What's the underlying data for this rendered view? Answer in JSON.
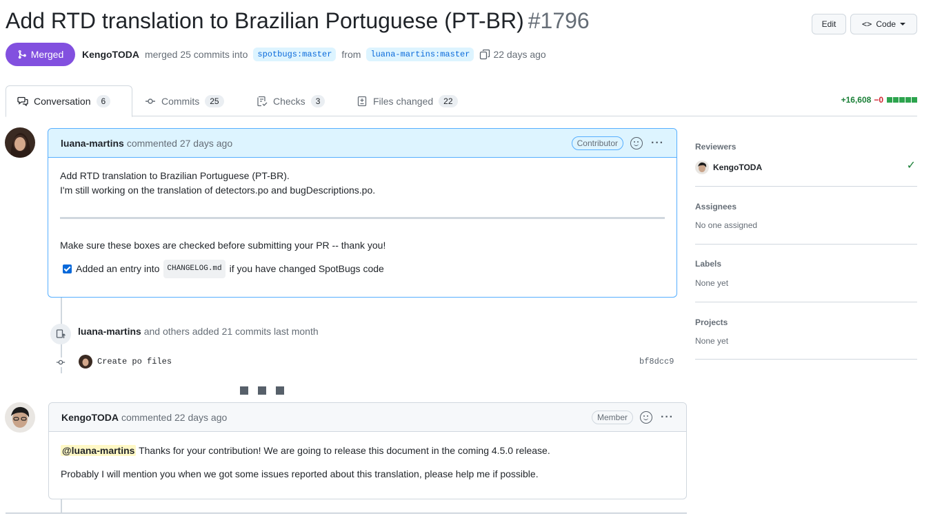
{
  "header": {
    "title": "Add RTD translation to Brazilian Portuguese (PT-BR)",
    "number": "#1796",
    "edit_label": "Edit",
    "code_label": "Code"
  },
  "meta": {
    "state": "Merged",
    "author": "KengoTODA",
    "merged_text": "merged 25 commits into",
    "base_branch": "spotbugs:master",
    "from_text": "from",
    "head_branch": "luana-martins:master",
    "time": "22 days ago"
  },
  "tabs": [
    {
      "label": "Conversation",
      "count": "6",
      "icon": "comment-discussion-icon"
    },
    {
      "label": "Commits",
      "count": "25",
      "icon": "git-commit-icon"
    },
    {
      "label": "Checks",
      "count": "3",
      "icon": "checklist-icon"
    },
    {
      "label": "Files changed",
      "count": "22",
      "icon": "file-diff-icon"
    }
  ],
  "diffstat": {
    "additions": "+16,608",
    "deletions": "−0"
  },
  "comment1": {
    "author": "luana-martins",
    "action": "commented 27 days ago",
    "role": "Contributor",
    "line1": "Add RTD translation to Brazilian Portuguese (PT-BR).",
    "line2": "I'm still working on the translation of detectors.po and bugDescriptions.po.",
    "checklist_intro": "Make sure these boxes are checked before submitting your PR -- thank you!",
    "check_prefix": "Added an entry into",
    "check_code": "CHANGELOG.md",
    "check_suffix": "if you have changed SpotBugs code"
  },
  "commits_event": {
    "author": "luana-martins",
    "text": "and others added 21 commits last month",
    "commit_message": "Create po files",
    "commit_sha": "bf8dcc9"
  },
  "comment2": {
    "author": "KengoTODA",
    "action": "commented 22 days ago",
    "role": "Member",
    "mention": "@luana-martins",
    "line1": "Thanks for your contribution! We are going to release this document in the coming 4.5.0 release.",
    "line2": "Probably I will mention you when we got some issues reported about this translation, please help me if possible."
  },
  "sidebar": {
    "reviewers_title": "Reviewers",
    "reviewer": "KengoTODA",
    "assignees_title": "Assignees",
    "assignees_value": "No one assigned",
    "labels_title": "Labels",
    "labels_value": "None yet",
    "projects_title": "Projects",
    "projects_value": "None yet"
  },
  "colors": {
    "merged": "#8250df",
    "accent": "#0969da",
    "additions": "#1a7f37",
    "deletions": "#cf222e"
  }
}
